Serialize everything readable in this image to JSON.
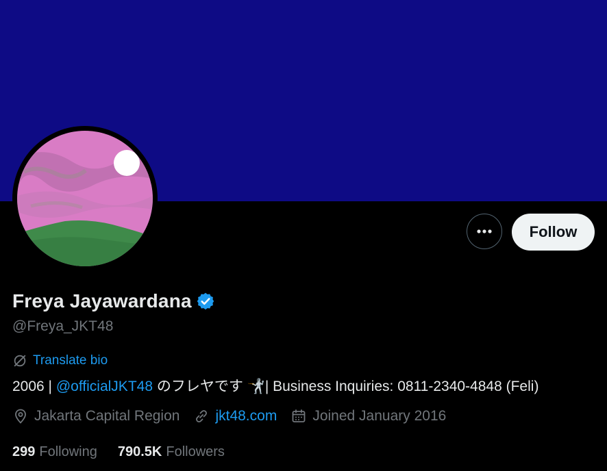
{
  "profile": {
    "display_name": "Freya Jayawardana",
    "handle": "@Freya_JKT48",
    "verified": true,
    "follow_label": "Follow",
    "more_label": "•••"
  },
  "bio": {
    "translate_label": "Translate bio",
    "prefix": "2006 | ",
    "mention": "@officialJKT48",
    "suffix": " のフレヤです 🤺| Business Inquiries: 0811-2340-4848 (Feli)"
  },
  "meta": {
    "location": "Jakarta Capital Region",
    "website": "jkt48.com",
    "joined": "Joined January 2016"
  },
  "stats": {
    "following_count": "299",
    "following_label": "Following",
    "followers_count": "790.5K",
    "followers_label": "Followers"
  },
  "colors": {
    "banner": "#0e0b85",
    "accent": "#1d9bf0",
    "muted": "#71767b"
  }
}
